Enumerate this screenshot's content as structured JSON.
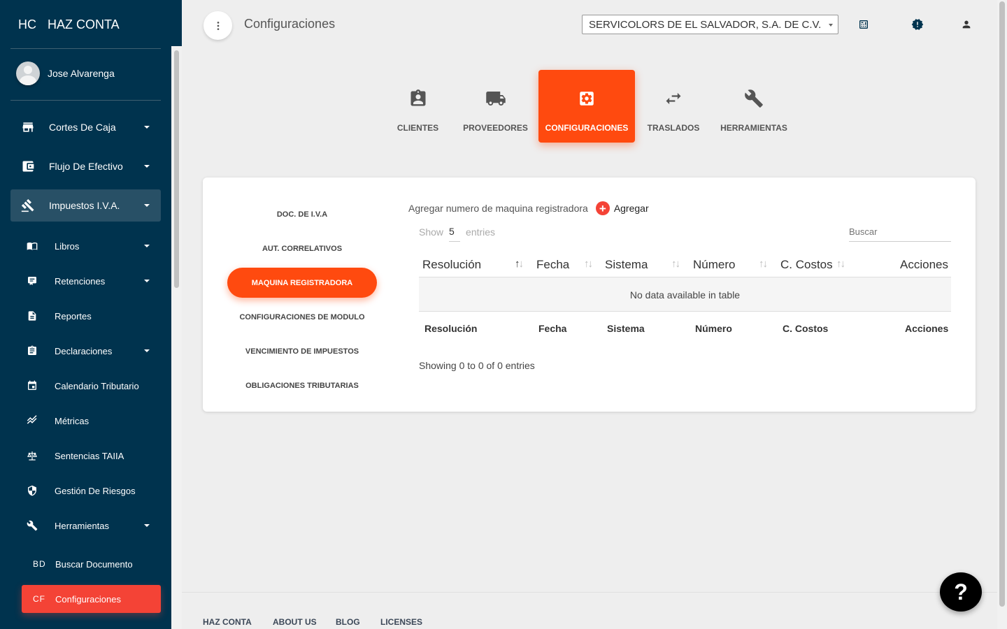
{
  "brand": {
    "mini": "HC",
    "name": "HAZ CONTA"
  },
  "user": {
    "name": "Jose Alvarenga"
  },
  "sidebar": {
    "items": [
      {
        "label": "Cortes De Caja",
        "icon": "store-icon"
      },
      {
        "label": "Flujo De Efectivo",
        "icon": "wallet-icon"
      },
      {
        "label": "Impuestos I.V.A.",
        "icon": "gavel-icon"
      }
    ],
    "sub_items": [
      {
        "label": "Libros",
        "icon": "book-icon"
      },
      {
        "label": "Retenciones",
        "icon": "receipt-icon"
      },
      {
        "label": "Reportes",
        "icon": "document-icon"
      },
      {
        "label": "Declaraciones",
        "icon": "clipboard-icon"
      },
      {
        "label": "Calendario Tributario",
        "icon": "calendar-icon"
      },
      {
        "label": "Métricas",
        "icon": "trending-icon"
      },
      {
        "label": "Sentencias TAIIA",
        "icon": "balance-icon"
      },
      {
        "label": "Gestión De Riesgos",
        "icon": "shield-icon"
      },
      {
        "label": "Herramientas",
        "icon": "wrench-icon"
      }
    ],
    "abbr_items": [
      {
        "abbr": "BD",
        "label": "Buscar Documento"
      },
      {
        "abbr": "CF",
        "label": "Configuraciones"
      }
    ]
  },
  "header": {
    "title": "Configuraciones",
    "company": "SERVICOLORS DE EL SALVADOR, S.A. DE C.V."
  },
  "tabs": [
    {
      "label": "CLIENTES",
      "icon": "assignment-ind-icon"
    },
    {
      "label": "PROVEEDORES",
      "icon": "truck-icon"
    },
    {
      "label": "CONFIGURACIONES",
      "icon": "settings-icon"
    },
    {
      "label": "TRASLADOS",
      "icon": "swap-icon"
    },
    {
      "label": "HERRAMIENTAS",
      "icon": "wrench-icon"
    }
  ],
  "config_menu": [
    "DOC. DE I.V.A",
    "AUT. CORRELATIVOS",
    "MAQUINA REGISTRADORA",
    "CONFIGURACIONES DE MODULO",
    "VENCIMIENTO DE IMPUESTOS",
    "OBLIGACIONES TRIBUTARIAS"
  ],
  "panel": {
    "add_text": "Agregar numero de maquina registradora",
    "add_button": "Agregar",
    "show_label": "Show",
    "show_value": "5",
    "entries_label": "entries",
    "search_placeholder": "Buscar",
    "columns": [
      "Resolución",
      "Fecha",
      "Sistema",
      "Número",
      "C. Costos",
      "Acciones"
    ],
    "empty_text": "No data available in table",
    "info_text": "Showing 0 to 0 of 0 entries"
  },
  "footer": {
    "links": [
      "HAZ CONTA",
      "ABOUT US",
      "BLOG",
      "LICENSES"
    ]
  },
  "help": {
    "label": "?"
  },
  "colors": {
    "sidebar": "#00334e",
    "accent": "#ff4a0f",
    "selected": "#f44336"
  }
}
